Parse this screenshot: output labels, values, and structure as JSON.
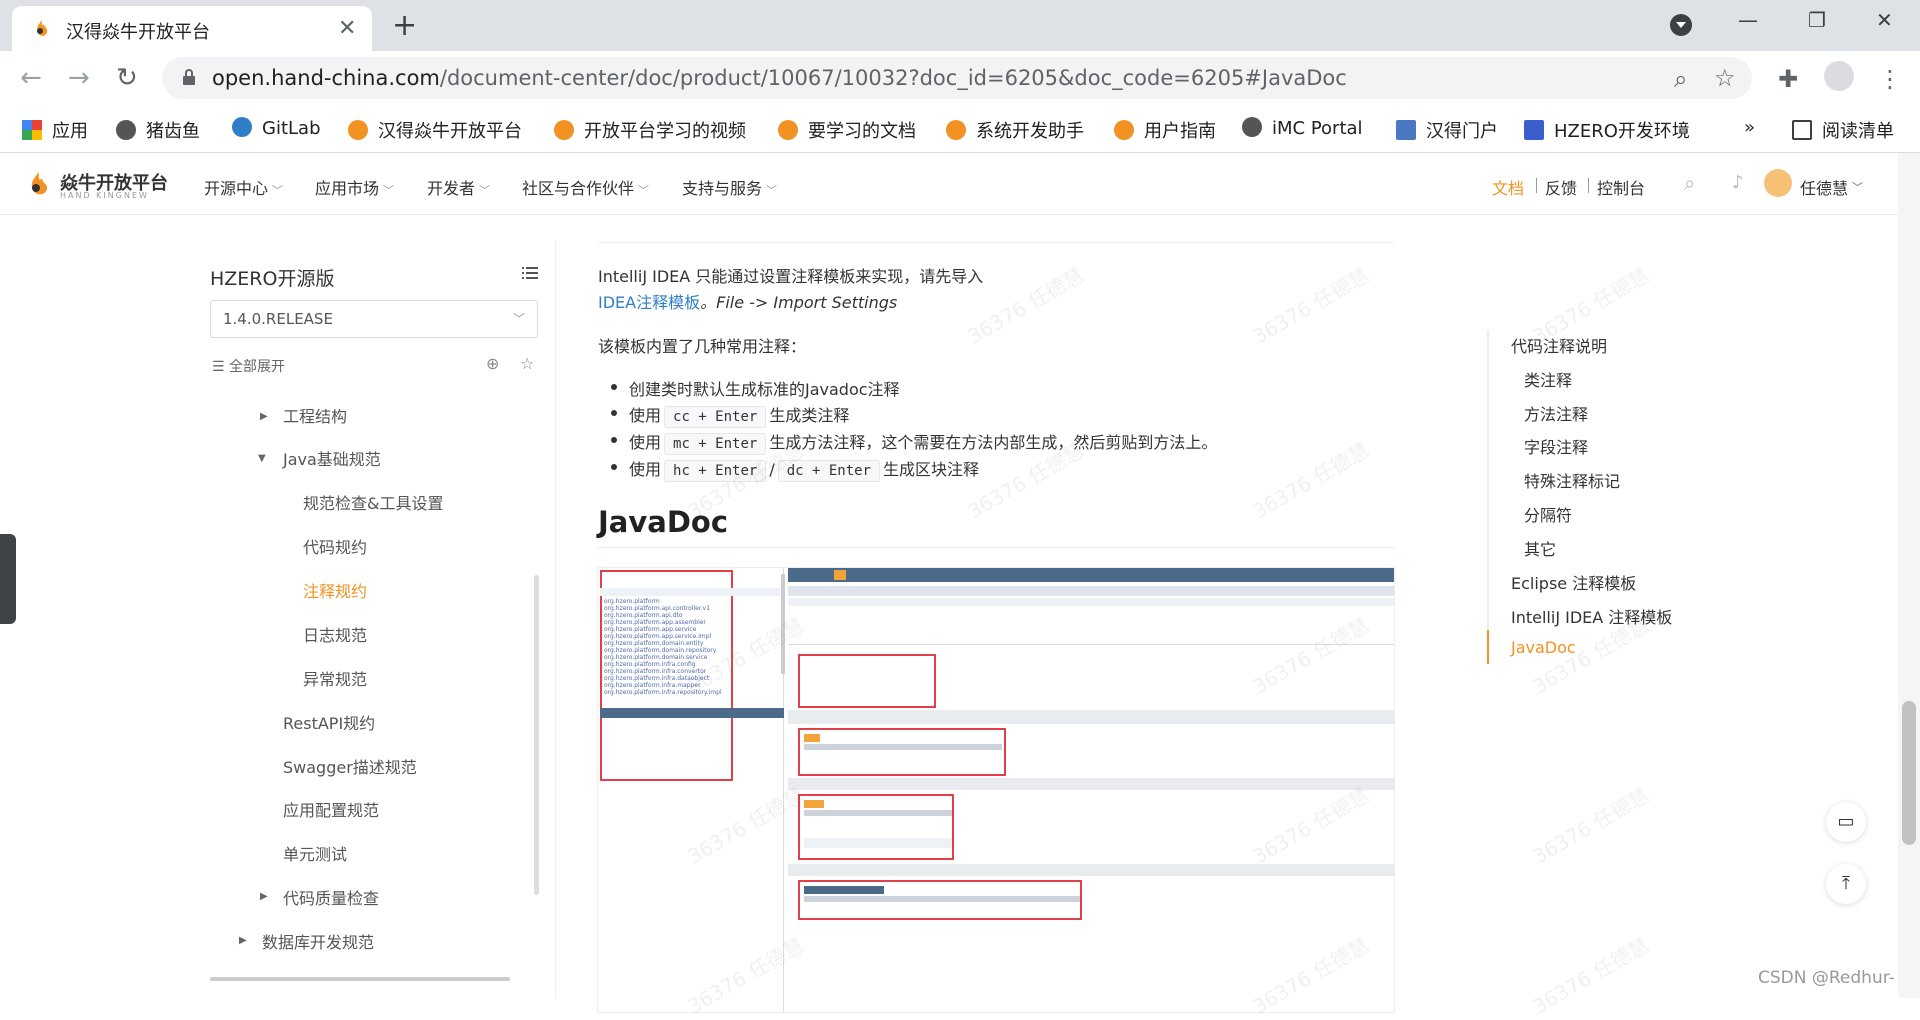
{
  "browser": {
    "tab_title": "汉得焱牛开放平台",
    "url_host": "open.hand-china.com",
    "url_path": "/document-center/doc/product/10067/10032?doc_id=6205&doc_code=6205#JavaDoc",
    "bookmarks": [
      "应用",
      "猪齿鱼",
      "GitLab",
      "汉得焱牛开放平台",
      "开放平台学习的视频",
      "要学习的文档",
      "系统开发助手",
      "用户指南",
      "iMC Portal",
      "汉得门户",
      "HZERO开发环境"
    ],
    "overflow": "»",
    "reading_list": "阅读清单"
  },
  "site": {
    "logo_name": "焱牛开放平台",
    "logo_sub": "HAND KINGNEW",
    "nav": [
      "开源中心",
      "应用市场",
      "开发者",
      "社区与合作伙伴",
      "支持与服务"
    ],
    "links": [
      "文档",
      "反馈",
      "控制台"
    ],
    "user": "任德慧",
    "brand_color": "#f29222"
  },
  "sidebar": {
    "title": "HZERO开源版",
    "version": "1.4.0.RELEASE",
    "expand_all": "全部展开",
    "tree": [
      {
        "label": "工程结构"
      },
      {
        "label": "Java基础规范"
      },
      {
        "label": "规范检查&工具设置"
      },
      {
        "label": "代码规约"
      },
      {
        "label": "注释规约"
      },
      {
        "label": "日志规范"
      },
      {
        "label": "异常规范"
      },
      {
        "label": "RestAPI规约"
      },
      {
        "label": "Swagger描述规范"
      },
      {
        "label": "应用配置规范"
      },
      {
        "label": "单元测试"
      },
      {
        "label": "代码质量检查"
      },
      {
        "label": "数据库开发规范"
      }
    ]
  },
  "doc": {
    "p1": "IntelliJ IDEA 只能通过设置注释模板来实现，请先导入",
    "p2_link": "IDEA注释模板",
    "p2_rest": "。File -> Import Settings",
    "p3": "该模板内置了几种常用注释：",
    "bullets": {
      "b1": "创建类时默认生成标准的Javadoc注释",
      "use": "使用",
      "k_cc": "cc + Enter",
      "b2": "生成类注释",
      "k_mc": "mc + Enter",
      "b3": "生成方法注释，这个需要在方法内部生成，然后剪贴到方法上。",
      "k_hc": "hc + Enter",
      "slash": "/",
      "k_dc": "dc + Enter",
      "b4": "生成区块注释"
    },
    "heading": "JavaDoc"
  },
  "toc": {
    "items": [
      "代码注释说明",
      "类注释",
      "方法注释",
      "字段注释",
      "特殊注释标记",
      "分隔符",
      "其它",
      "Eclipse 注释模板",
      "IntelliJ IDEA 注释模板",
      "JavaDoc"
    ]
  },
  "watermark": "36376 任德慧",
  "footer_credit": "CSDN @Redhur-"
}
